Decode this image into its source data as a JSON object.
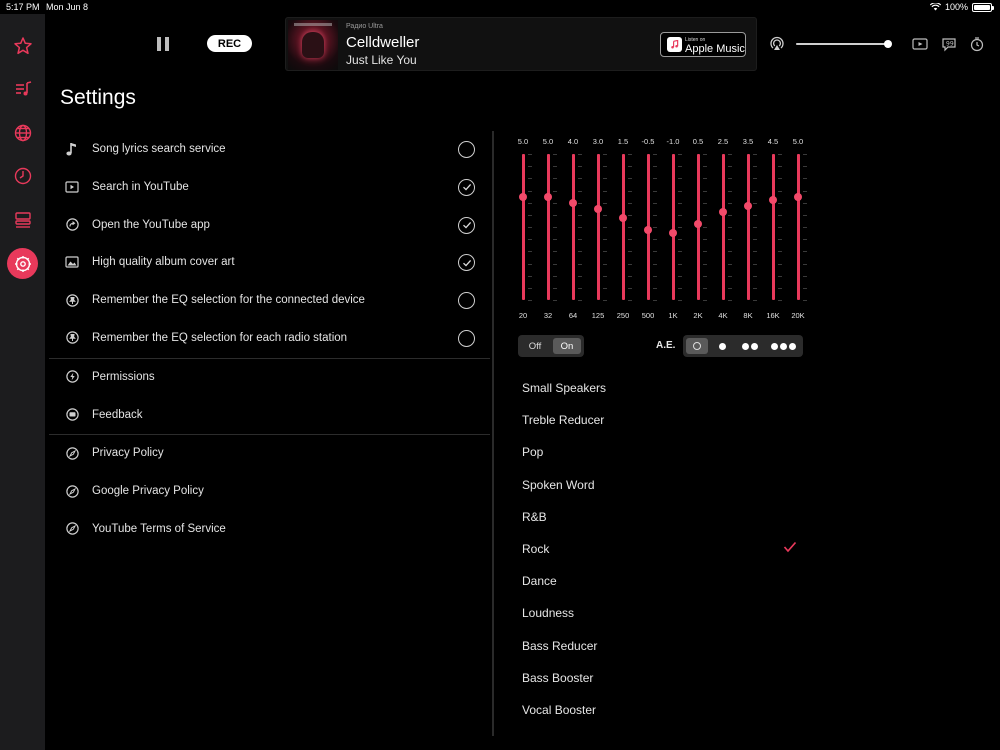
{
  "status_bar": {
    "time": "5:17 PM",
    "date": "Mon Jun 8",
    "battery": "100%",
    "battery_level_pct": 100
  },
  "rail": {
    "items": [
      {
        "name": "favorites",
        "icon": "star-icon",
        "active": false
      },
      {
        "name": "playlist",
        "icon": "music-list-icon",
        "active": false
      },
      {
        "name": "browse",
        "icon": "globe-icon",
        "active": false
      },
      {
        "name": "history",
        "icon": "clock-icon",
        "active": false
      },
      {
        "name": "stations",
        "icon": "list-icon",
        "active": false
      },
      {
        "name": "settings",
        "icon": "gear-icon",
        "active": true
      }
    ],
    "accent_color": "#e8395b"
  },
  "player": {
    "rec_label": "REC",
    "station": "Радио Ultra",
    "artist": "Celldweller",
    "song": "Just Like You",
    "apple_music": {
      "small": "Listen on",
      "big": "Apple Music"
    },
    "volume_pct": 100
  },
  "settings": {
    "title": "Settings",
    "options": [
      {
        "label": "Song lyrics search service",
        "icon": "music-note-icon",
        "checked": false
      },
      {
        "label": "Search in YouTube",
        "icon": "play-box-icon",
        "checked": true
      },
      {
        "label": "Open the YouTube app",
        "icon": "share-arrow-icon",
        "checked": true
      },
      {
        "label": "High quality album cover art",
        "icon": "image-icon",
        "checked": true
      },
      {
        "label": "Remember the EQ selection for the connected device",
        "icon": "pin-icon",
        "checked": false
      },
      {
        "label": "Remember the EQ selection for each radio station",
        "icon": "pin-icon",
        "checked": false
      }
    ],
    "links_group1": [
      {
        "label": "Permissions",
        "icon": "bolt-icon"
      },
      {
        "label": "Feedback",
        "icon": "chat-icon"
      }
    ],
    "links_group2": [
      {
        "label": "Privacy Policy",
        "icon": "compass-icon"
      },
      {
        "label": "Google Privacy Policy",
        "icon": "compass-icon"
      },
      {
        "label": "YouTube Terms of Service",
        "icon": "compass-icon"
      }
    ]
  },
  "equalizer": {
    "bands": [
      {
        "freq": "20",
        "gain": "5.0"
      },
      {
        "freq": "32",
        "gain": "5.0"
      },
      {
        "freq": "64",
        "gain": "4.0"
      },
      {
        "freq": "125",
        "gain": "3.0"
      },
      {
        "freq": "250",
        "gain": "1.5"
      },
      {
        "freq": "500",
        "gain": "-0.5"
      },
      {
        "freq": "1K",
        "gain": "-1.0"
      },
      {
        "freq": "2K",
        "gain": "0.5"
      },
      {
        "freq": "4K",
        "gain": "2.5"
      },
      {
        "freq": "8K",
        "gain": "3.5"
      },
      {
        "freq": "16K",
        "gain": "4.5"
      },
      {
        "freq": "20K",
        "gain": "5.0"
      }
    ],
    "gain_range": [
      -12,
      12
    ],
    "toggle": {
      "off": "Off",
      "on": "On",
      "selected": "On"
    },
    "ae": {
      "label": "A.E.",
      "options": 4,
      "selected": 0
    },
    "presets": [
      {
        "label": "Small Speakers",
        "selected": false
      },
      {
        "label": "Treble Reducer",
        "selected": false
      },
      {
        "label": "Pop",
        "selected": false
      },
      {
        "label": "Spoken Word",
        "selected": false
      },
      {
        "label": "R&B",
        "selected": false
      },
      {
        "label": "Rock",
        "selected": true
      },
      {
        "label": "Dance",
        "selected": false
      },
      {
        "label": "Loudness",
        "selected": false
      },
      {
        "label": "Bass Reducer",
        "selected": false
      },
      {
        "label": "Bass Booster",
        "selected": false
      },
      {
        "label": "Vocal Booster",
        "selected": false
      }
    ]
  }
}
